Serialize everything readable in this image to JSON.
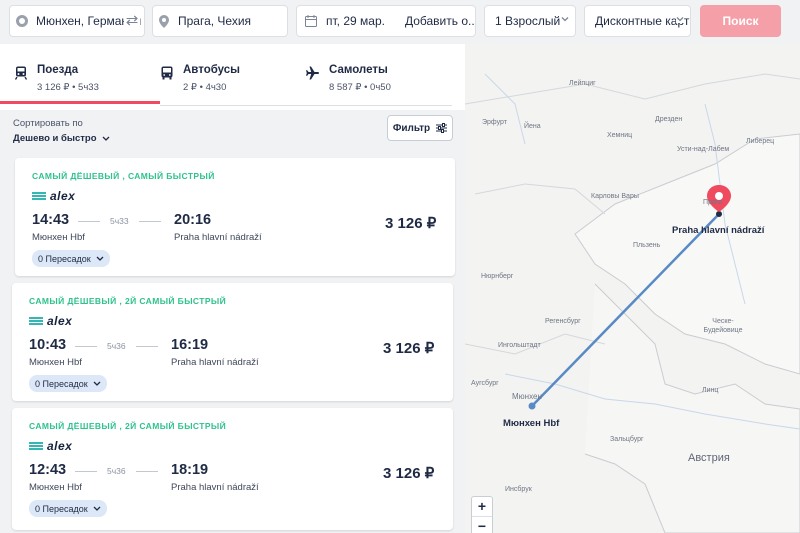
{
  "search": {
    "from": "Мюнхен, Германия",
    "to": "Прага, Чехия",
    "date": "пт, 29 мар.",
    "add_return": "Добавить о...",
    "passengers": "1 Взрослый",
    "discount": "Дисконтные карты",
    "search_button": "Поиск"
  },
  "tabs": [
    {
      "title": "Поезда",
      "sub": "3 126 ₽ • 5ч33",
      "icon": "train-icon"
    },
    {
      "title": "Автобусы",
      "sub": "2 ₽ • 4ч30",
      "icon": "bus-icon"
    },
    {
      "title": "Самолеты",
      "sub": "8 587 ₽ • 0ч50",
      "icon": "plane-icon"
    }
  ],
  "sort": {
    "label": "Сортировать по",
    "value": "Дешево и быстро"
  },
  "filter_label": "Фильтр",
  "results": [
    {
      "tag": "САМЫЙ ДЁШЕВЫЙ , САМЫЙ БЫСТРЫЙ",
      "carrier": "alex",
      "dep_time": "14:43",
      "arr_time": "20:16",
      "duration": "5ч33",
      "dep_station": "Мюнхен Hbf",
      "arr_station": "Praha hlavní nádraží",
      "price": "3 126 ₽",
      "transfers": "0 Пересадок"
    },
    {
      "tag": "САМЫЙ ДЁШЕВЫЙ , 2Й САМЫЙ БЫСТРЫЙ",
      "carrier": "alex",
      "dep_time": "10:43",
      "arr_time": "16:19",
      "duration": "5ч36",
      "dep_station": "Мюнхен Hbf",
      "arr_station": "Praha hlavní nádraží",
      "price": "3 126 ₽",
      "transfers": "0 Пересадок"
    },
    {
      "tag": "САМЫЙ ДЁШЕВЫЙ , 2Й САМЫЙ БЫСТРЫЙ",
      "carrier": "alex",
      "dep_time": "12:43",
      "arr_time": "18:19",
      "duration": "5ч36",
      "dep_station": "Мюнхен Hbf",
      "arr_station": "Praha hlavní nádraží",
      "price": "3 126 ₽",
      "transfers": "0 Пересадок"
    }
  ],
  "map": {
    "labels": [
      "Лейпциг",
      "Эрфурт",
      "Йена",
      "Дрезден",
      "Хемниц",
      "Усти-над-Лабем",
      "Либерец",
      "Карловы Вары",
      "Прага",
      "Пльзень",
      "Нюрнберг",
      "Регенсбург",
      "Ческе-Будейовице",
      "Ингольштадт",
      "Аугсбург",
      "Мюнхен",
      "Линц",
      "Зальцбург",
      "Инсбрук"
    ],
    "origin_label": "Мюнхен Hbf",
    "destination_label": "Praha hlavní nádraží",
    "country_label": "Австрия",
    "zoom_in": "+",
    "zoom_out": "−",
    "route_color": "#5a8ac6",
    "pin_color": "#f04a5e"
  },
  "colors": {
    "accent": "#f04a5e",
    "tag_green": "#2fc28d",
    "search_button": "#f5a0a8"
  }
}
